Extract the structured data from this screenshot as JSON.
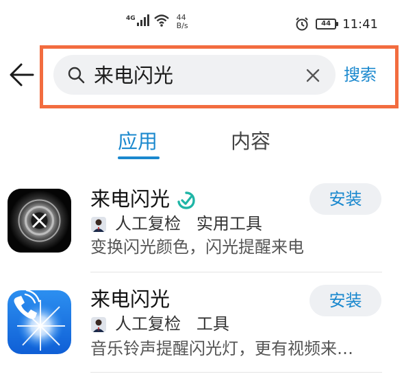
{
  "status_bar": {
    "network_type": "4G",
    "net_speed_value": "44",
    "net_speed_unit": "B/s",
    "battery_level": "44",
    "time": "11:41"
  },
  "search": {
    "query": "来电闪光",
    "submit_label": "搜索"
  },
  "tabs": [
    {
      "label": "应用",
      "active": true
    },
    {
      "label": "内容",
      "active": false
    }
  ],
  "apps": [
    {
      "name": "来电闪光",
      "verified": true,
      "review": "人工复检",
      "category": "实用工具",
      "description": "变换闪光颜色，闪光提醒来电",
      "install_label": "安装"
    },
    {
      "name": "来电闪光",
      "verified": false,
      "review": "人工复检",
      "category": "工具",
      "description": "音乐铃声提醒闪光灯，更有视频来…",
      "install_label": "安装"
    }
  ],
  "colors": {
    "accent": "#1a88ce",
    "highlight_border": "#f26c3f",
    "search_bg": "#f0f1f3"
  }
}
